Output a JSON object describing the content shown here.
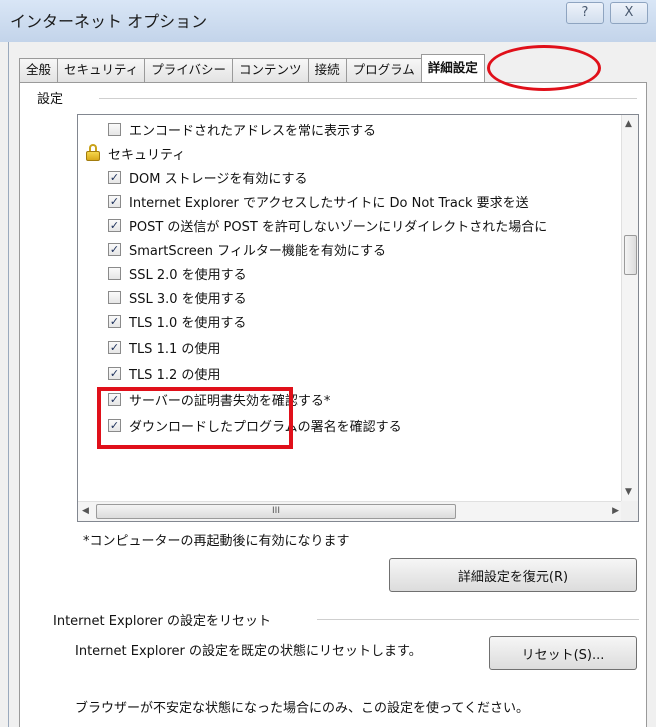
{
  "window": {
    "title": "インターネット オプション",
    "help_button": "?",
    "close_button": "X"
  },
  "tabs": [
    {
      "label": "全般",
      "active": false
    },
    {
      "label": "セキュリティ",
      "active": false
    },
    {
      "label": "プライバシー",
      "active": false
    },
    {
      "label": "コンテンツ",
      "active": false
    },
    {
      "label": "接続",
      "active": false
    },
    {
      "label": "プログラム",
      "active": false
    },
    {
      "label": "詳細設定",
      "active": true
    }
  ],
  "settings": {
    "group_label": "設定",
    "items": [
      {
        "type": "checkbox",
        "checked": false,
        "label": "エンコードされたアドレスを常に表示する"
      },
      {
        "type": "category",
        "icon": "lock-icon",
        "label": "セキュリティ"
      },
      {
        "type": "checkbox",
        "checked": true,
        "label": "DOM ストレージを有効にする"
      },
      {
        "type": "checkbox",
        "checked": true,
        "label": "Internet Explorer でアクセスしたサイトに Do Not Track 要求を送"
      },
      {
        "type": "checkbox",
        "checked": true,
        "label": "POST の送信が POST を許可しないゾーンにリダイレクトされた場合に"
      },
      {
        "type": "checkbox",
        "checked": true,
        "label": "SmartScreen フィルター機能を有効にする"
      },
      {
        "type": "checkbox",
        "checked": false,
        "label": "SSL 2.0 を使用する"
      },
      {
        "type": "checkbox",
        "checked": false,
        "label": "SSL 3.0 を使用する"
      },
      {
        "type": "checkbox",
        "checked": true,
        "label": "TLS 1.0 を使用する"
      },
      {
        "type": "checkbox",
        "checked": true,
        "label": "TLS 1.1 の使用"
      },
      {
        "type": "checkbox",
        "checked": true,
        "label": "TLS 1.2 の使用"
      },
      {
        "type": "checkbox",
        "checked": true,
        "label": "サーバーの証明書失効を確認する*"
      },
      {
        "type": "checkbox",
        "checked": true,
        "label": "ダウンロードしたプログラムの署名を確認する"
      }
    ],
    "hscroll_thumb": "III",
    "restart_note": "*コンピューターの再起動後に有効になります",
    "restore_button": "詳細設定を復元(R)"
  },
  "reset": {
    "group_label": "Internet Explorer の設定をリセット",
    "description": "Internet Explorer の設定を既定の状態にリセットします。",
    "button": "リセット(S)...",
    "warning": "ブラウザーが不安定な状態になった場合にのみ、この設定を使ってください。"
  },
  "colors": {
    "highlight": "#e0101a",
    "title_bar": "#c3d4ea"
  }
}
